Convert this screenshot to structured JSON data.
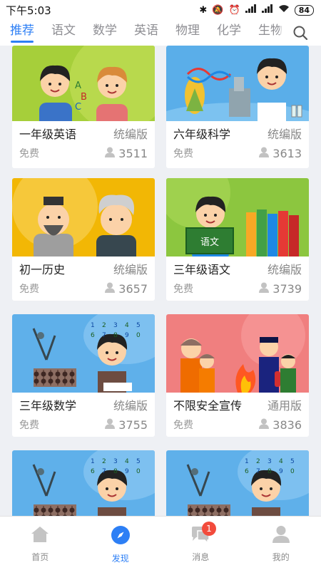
{
  "status_bar": {
    "time": "下午5:03",
    "battery": "84"
  },
  "tabs": [
    {
      "label": "推荐",
      "active": true
    },
    {
      "label": "语文",
      "active": false
    },
    {
      "label": "数学",
      "active": false
    },
    {
      "label": "英语",
      "active": false
    },
    {
      "label": "物理",
      "active": false
    },
    {
      "label": "化学",
      "active": false
    },
    {
      "label": "生物",
      "active": false
    }
  ],
  "search": {
    "icon": "search-icon"
  },
  "courses": [
    {
      "title": "一年级英语",
      "edition": "统编版",
      "price": "免费",
      "learners": "3511",
      "theme": "english"
    },
    {
      "title": "六年级科学",
      "edition": "统编版",
      "price": "免费",
      "learners": "3613",
      "theme": "science"
    },
    {
      "title": "初一历史",
      "edition": "统编版",
      "price": "免费",
      "learners": "3657",
      "theme": "history"
    },
    {
      "title": "三年级语文",
      "edition": "统编版",
      "price": "免费",
      "learners": "3739",
      "theme": "chinese",
      "book_text": "语文"
    },
    {
      "title": "三年级数学",
      "edition": "统编版",
      "price": "免费",
      "learners": "3755",
      "theme": "math"
    },
    {
      "title": "不限安全宣传",
      "edition": "通用版",
      "price": "免费",
      "learners": "3836",
      "theme": "safety"
    },
    {
      "title": "",
      "edition": "",
      "price": "",
      "learners": "",
      "theme": "math"
    },
    {
      "title": "",
      "edition": "",
      "price": "",
      "learners": "",
      "theme": "math"
    }
  ],
  "bottom_nav": [
    {
      "label": "首页",
      "icon": "home-icon",
      "active": false
    },
    {
      "label": "发现",
      "icon": "compass-icon",
      "active": true
    },
    {
      "label": "消息",
      "icon": "message-icon",
      "active": false,
      "badge": "1"
    },
    {
      "label": "我的",
      "icon": "profile-icon",
      "active": false
    }
  ],
  "colors": {
    "accent": "#2d7ff5",
    "badge": "#f24b3c",
    "page_bg": "#eef0f4"
  }
}
